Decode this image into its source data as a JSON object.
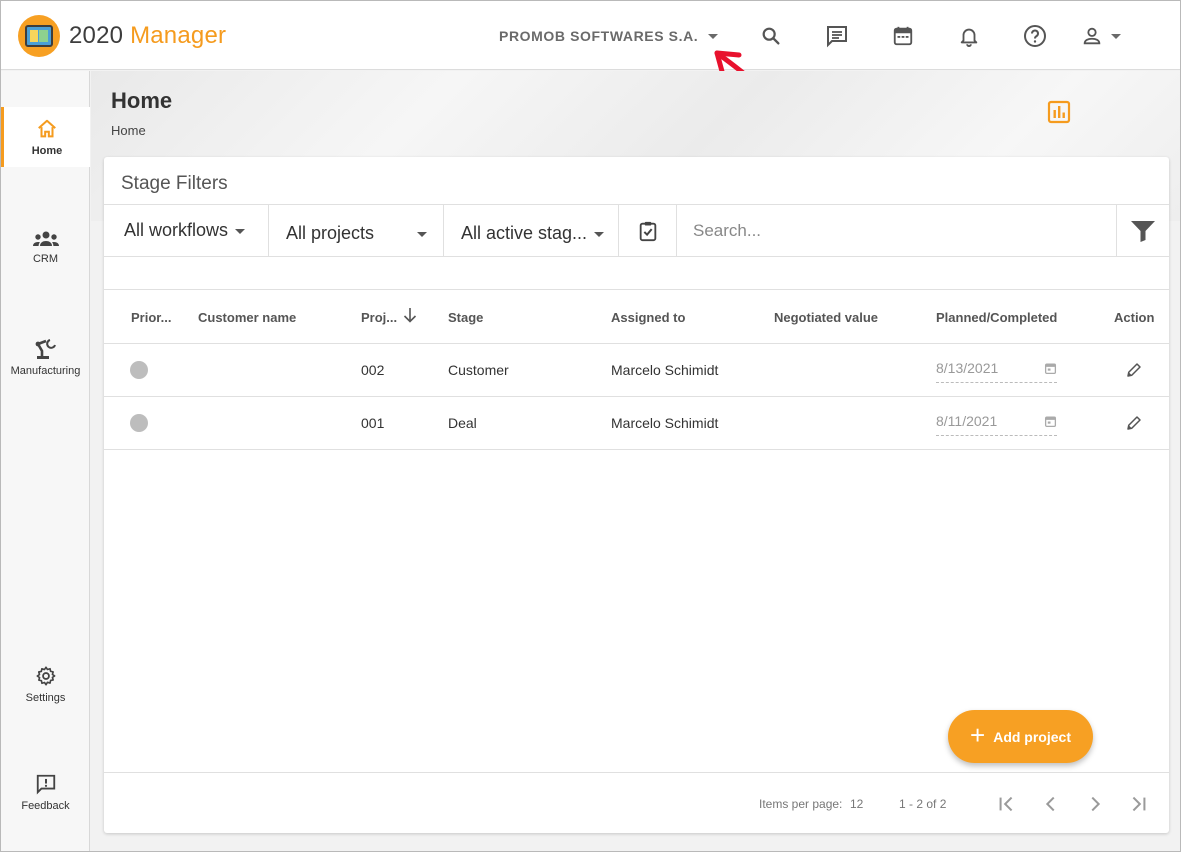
{
  "app": {
    "logo_text_primary": "2020",
    "logo_text_secondary": " Manager"
  },
  "header": {
    "company": "PROMOB SOFTWARES S.A.",
    "icons": [
      "search-icon",
      "chat-icon",
      "calendar-icon",
      "bell-icon",
      "help-icon",
      "account-icon"
    ]
  },
  "sidebar": {
    "items": [
      {
        "label": "Home",
        "icon": "home-icon",
        "active": true
      },
      {
        "label": "CRM",
        "icon": "people-icon",
        "active": false
      },
      {
        "label": "Manufacturing",
        "icon": "robot-arm-icon",
        "active": false
      },
      {
        "label": "Settings",
        "icon": "gear-icon",
        "active": false
      },
      {
        "label": "Feedback",
        "icon": "feedback-icon",
        "active": false
      }
    ]
  },
  "page": {
    "title": "Home",
    "breadcrumb": "Home"
  },
  "stage_filters": {
    "title": "Stage Filters",
    "workflow": "All workflows",
    "projects": "All projects",
    "stages": "All active stag...",
    "search_placeholder": "Search..."
  },
  "table": {
    "columns": [
      "Prior...",
      "Customer name",
      "Proj...",
      "Stage",
      "Assigned to",
      "Negotiated value",
      "Planned/Completed",
      "Action"
    ],
    "rows": [
      {
        "priority": "",
        "customer": "",
        "project": "002",
        "stage": "Customer",
        "assigned": "Marcelo Schimidt",
        "value": "",
        "date": "8/13/2021"
      },
      {
        "priority": "",
        "customer": "",
        "project": "001",
        "stage": "Deal",
        "assigned": "Marcelo Schimidt",
        "value": "",
        "date": "8/11/2021"
      }
    ]
  },
  "fab": {
    "label": "Add project"
  },
  "paginator": {
    "items_per_page_label": "Items per page:",
    "items_per_page": "12",
    "range": "1 - 2 of 2"
  },
  "colors": {
    "accent": "#f7a023",
    "annotation": "#e8112d"
  }
}
